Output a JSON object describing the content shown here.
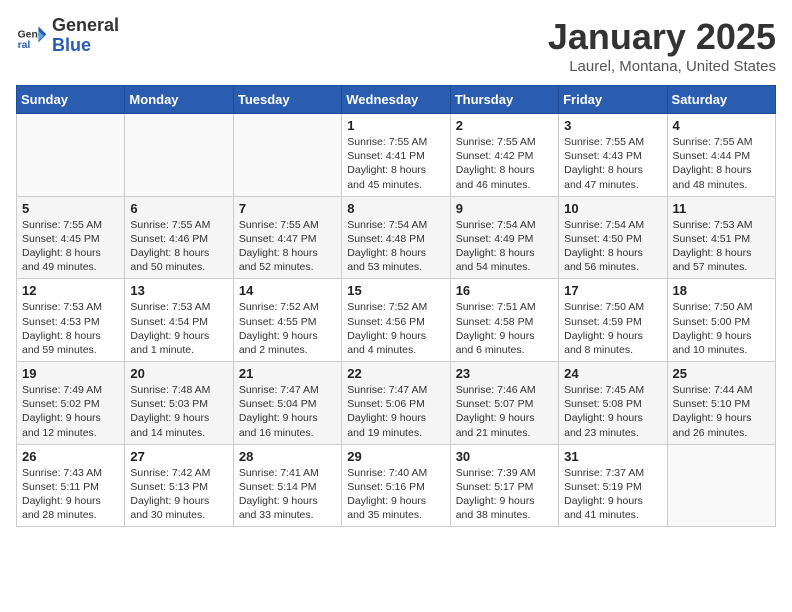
{
  "header": {
    "logo_general": "General",
    "logo_blue": "Blue",
    "month_title": "January 2025",
    "location": "Laurel, Montana, United States"
  },
  "weekdays": [
    "Sunday",
    "Monday",
    "Tuesday",
    "Wednesday",
    "Thursday",
    "Friday",
    "Saturday"
  ],
  "weeks": [
    [
      {
        "day": "",
        "info": ""
      },
      {
        "day": "",
        "info": ""
      },
      {
        "day": "",
        "info": ""
      },
      {
        "day": "1",
        "info": "Sunrise: 7:55 AM\nSunset: 4:41 PM\nDaylight: 8 hours\nand 45 minutes."
      },
      {
        "day": "2",
        "info": "Sunrise: 7:55 AM\nSunset: 4:42 PM\nDaylight: 8 hours\nand 46 minutes."
      },
      {
        "day": "3",
        "info": "Sunrise: 7:55 AM\nSunset: 4:43 PM\nDaylight: 8 hours\nand 47 minutes."
      },
      {
        "day": "4",
        "info": "Sunrise: 7:55 AM\nSunset: 4:44 PM\nDaylight: 8 hours\nand 48 minutes."
      }
    ],
    [
      {
        "day": "5",
        "info": "Sunrise: 7:55 AM\nSunset: 4:45 PM\nDaylight: 8 hours\nand 49 minutes."
      },
      {
        "day": "6",
        "info": "Sunrise: 7:55 AM\nSunset: 4:46 PM\nDaylight: 8 hours\nand 50 minutes."
      },
      {
        "day": "7",
        "info": "Sunrise: 7:55 AM\nSunset: 4:47 PM\nDaylight: 8 hours\nand 52 minutes."
      },
      {
        "day": "8",
        "info": "Sunrise: 7:54 AM\nSunset: 4:48 PM\nDaylight: 8 hours\nand 53 minutes."
      },
      {
        "day": "9",
        "info": "Sunrise: 7:54 AM\nSunset: 4:49 PM\nDaylight: 8 hours\nand 54 minutes."
      },
      {
        "day": "10",
        "info": "Sunrise: 7:54 AM\nSunset: 4:50 PM\nDaylight: 8 hours\nand 56 minutes."
      },
      {
        "day": "11",
        "info": "Sunrise: 7:53 AM\nSunset: 4:51 PM\nDaylight: 8 hours\nand 57 minutes."
      }
    ],
    [
      {
        "day": "12",
        "info": "Sunrise: 7:53 AM\nSunset: 4:53 PM\nDaylight: 8 hours\nand 59 minutes."
      },
      {
        "day": "13",
        "info": "Sunrise: 7:53 AM\nSunset: 4:54 PM\nDaylight: 9 hours\nand 1 minute."
      },
      {
        "day": "14",
        "info": "Sunrise: 7:52 AM\nSunset: 4:55 PM\nDaylight: 9 hours\nand 2 minutes."
      },
      {
        "day": "15",
        "info": "Sunrise: 7:52 AM\nSunset: 4:56 PM\nDaylight: 9 hours\nand 4 minutes."
      },
      {
        "day": "16",
        "info": "Sunrise: 7:51 AM\nSunset: 4:58 PM\nDaylight: 9 hours\nand 6 minutes."
      },
      {
        "day": "17",
        "info": "Sunrise: 7:50 AM\nSunset: 4:59 PM\nDaylight: 9 hours\nand 8 minutes."
      },
      {
        "day": "18",
        "info": "Sunrise: 7:50 AM\nSunset: 5:00 PM\nDaylight: 9 hours\nand 10 minutes."
      }
    ],
    [
      {
        "day": "19",
        "info": "Sunrise: 7:49 AM\nSunset: 5:02 PM\nDaylight: 9 hours\nand 12 minutes."
      },
      {
        "day": "20",
        "info": "Sunrise: 7:48 AM\nSunset: 5:03 PM\nDaylight: 9 hours\nand 14 minutes."
      },
      {
        "day": "21",
        "info": "Sunrise: 7:47 AM\nSunset: 5:04 PM\nDaylight: 9 hours\nand 16 minutes."
      },
      {
        "day": "22",
        "info": "Sunrise: 7:47 AM\nSunset: 5:06 PM\nDaylight: 9 hours\nand 19 minutes."
      },
      {
        "day": "23",
        "info": "Sunrise: 7:46 AM\nSunset: 5:07 PM\nDaylight: 9 hours\nand 21 minutes."
      },
      {
        "day": "24",
        "info": "Sunrise: 7:45 AM\nSunset: 5:08 PM\nDaylight: 9 hours\nand 23 minutes."
      },
      {
        "day": "25",
        "info": "Sunrise: 7:44 AM\nSunset: 5:10 PM\nDaylight: 9 hours\nand 26 minutes."
      }
    ],
    [
      {
        "day": "26",
        "info": "Sunrise: 7:43 AM\nSunset: 5:11 PM\nDaylight: 9 hours\nand 28 minutes."
      },
      {
        "day": "27",
        "info": "Sunrise: 7:42 AM\nSunset: 5:13 PM\nDaylight: 9 hours\nand 30 minutes."
      },
      {
        "day": "28",
        "info": "Sunrise: 7:41 AM\nSunset: 5:14 PM\nDaylight: 9 hours\nand 33 minutes."
      },
      {
        "day": "29",
        "info": "Sunrise: 7:40 AM\nSunset: 5:16 PM\nDaylight: 9 hours\nand 35 minutes."
      },
      {
        "day": "30",
        "info": "Sunrise: 7:39 AM\nSunset: 5:17 PM\nDaylight: 9 hours\nand 38 minutes."
      },
      {
        "day": "31",
        "info": "Sunrise: 7:37 AM\nSunset: 5:19 PM\nDaylight: 9 hours\nand 41 minutes."
      },
      {
        "day": "",
        "info": ""
      }
    ]
  ]
}
